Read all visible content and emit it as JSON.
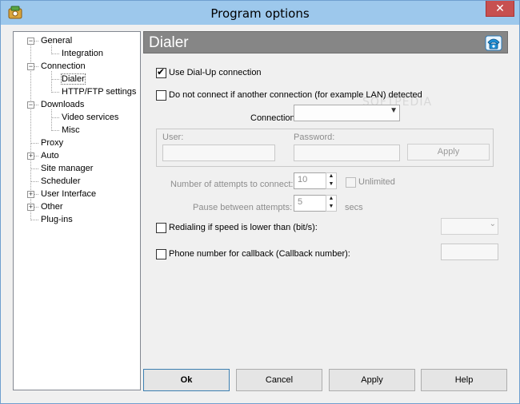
{
  "window": {
    "title": "Program options",
    "close_glyph": "✕"
  },
  "tree": [
    {
      "label": "General",
      "expander": "−"
    },
    {
      "label": "Integration"
    },
    {
      "label": "Connection",
      "expander": "−"
    },
    {
      "label": "Dialer",
      "selected": true
    },
    {
      "label": "HTTP/FTP settings"
    },
    {
      "label": "Downloads",
      "expander": "−"
    },
    {
      "label": "Video services"
    },
    {
      "label": "Misc"
    },
    {
      "label": "Proxy"
    },
    {
      "label": "Auto",
      "expander": "+"
    },
    {
      "label": "Site manager"
    },
    {
      "label": "Scheduler"
    },
    {
      "label": "User Interface",
      "expander": "+"
    },
    {
      "label": "Other",
      "expander": "+"
    },
    {
      "label": "Plug-ins"
    }
  ],
  "panel": {
    "title": "Dialer",
    "icon": "phone-icon",
    "use_dialup": {
      "label": "Use Dial-Up connection",
      "checked": true
    },
    "no_connect": {
      "label": "Do not connect if another connection (for example LAN) detected",
      "checked": false
    },
    "connection_label": "Connection:",
    "user_label": "User:",
    "password_label": "Password:",
    "apply_small": "Apply",
    "attempts_label": "Number of attempts to connect:",
    "attempts_value": "10",
    "unlimited_label": "Unlimited",
    "pause_label": "Pause between attempts:",
    "pause_value": "5",
    "pause_unit": "secs",
    "redial": {
      "label": "Redialing if speed is lower than (bit/s):",
      "checked": false
    },
    "callback": {
      "label": "Phone number for callback (Callback number):",
      "checked": false
    }
  },
  "buttons": {
    "ok": "Ok",
    "cancel": "Cancel",
    "apply": "Apply",
    "help": "Help"
  },
  "watermark": "SOFTPEDIA"
}
